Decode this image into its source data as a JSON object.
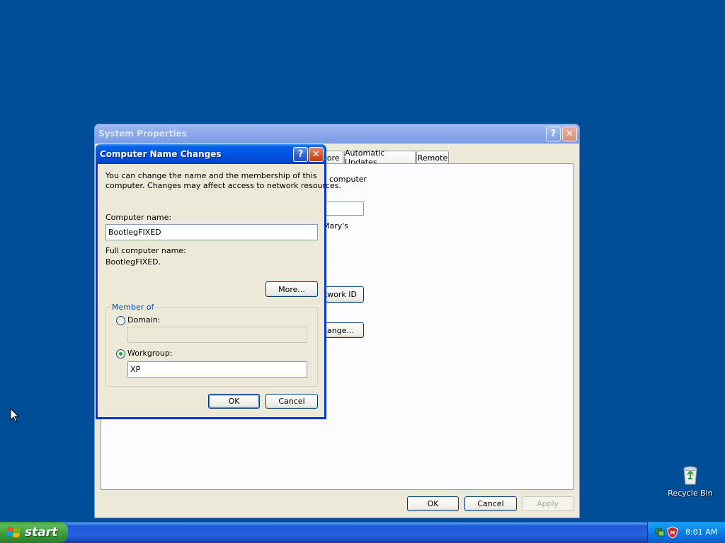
{
  "system_properties": {
    "title": "System Properties",
    "tabs": [
      "tore",
      "Automatic Updates",
      "Remote"
    ],
    "panel_texts": {
      "line1": "computer",
      "line2": "Mary's"
    },
    "buttons": {
      "network_id": "twork ID",
      "change": "nange...",
      "ok": "OK",
      "cancel": "Cancel",
      "apply": "Apply"
    }
  },
  "dialog": {
    "title": "Computer Name Changes",
    "description": "You can change the name and the membership of this computer. Changes may affect access to network resources.",
    "description_line1": "You can change the name and the membership of this",
    "description_line2": "computer. Changes may affect access to network resources.",
    "computer_name_label": "Computer name:",
    "computer_name_value": "BootlegFIXED",
    "full_name_label": "Full computer name:",
    "full_name_value": "BootlegFIXED.",
    "more_button": "More...",
    "member_of_legend": "Member of",
    "domain_label": "Domain:",
    "domain_value": "",
    "workgroup_label": "Workgroup:",
    "workgroup_value": "XP",
    "selected_membership": "Workgroup",
    "ok_button": "OK",
    "cancel_button": "Cancel"
  },
  "desktop": {
    "recycle_bin_label": "Recycle Bin",
    "background_color": "#004e98"
  },
  "taskbar": {
    "start_label": "start",
    "clock": "8:01 AM",
    "tray_icons": [
      "network-icon",
      "security-shield-icon"
    ]
  },
  "colors": {
    "active_title": "#0054e3",
    "inactive_title": "#8ba7ea",
    "dialog_face": "#ece9d8",
    "start_green": "#3a9a3a"
  }
}
